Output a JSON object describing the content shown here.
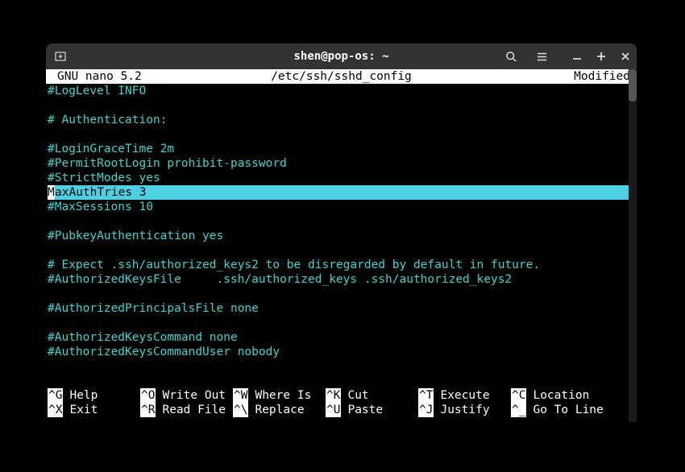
{
  "window": {
    "title": "shen@pop-os: ~"
  },
  "nano": {
    "header_title": "GNU nano 5.2",
    "header_file": "/etc/ssh/sshd_config",
    "header_status": "Modified"
  },
  "lines": [
    {
      "text": "#LogLevel INFO",
      "class": "cyan"
    },
    {
      "text": "",
      "class": ""
    },
    {
      "text": "# Authentication:",
      "class": "cyan"
    },
    {
      "text": "",
      "class": ""
    },
    {
      "text": "#LoginGraceTime 2m",
      "class": "cyan"
    },
    {
      "text": "#PermitRootLogin prohibit-password",
      "class": "cyan"
    },
    {
      "text": "#StrictModes yes",
      "class": "cyan"
    },
    {
      "text": "MaxAuthTries 3",
      "class": "highlighted",
      "cursor_char": "M",
      "rest": "axAuthTries 3"
    },
    {
      "text": "#MaxSessions 10",
      "class": "cyan"
    },
    {
      "text": "",
      "class": ""
    },
    {
      "text": "#PubkeyAuthentication yes",
      "class": "cyan"
    },
    {
      "text": "",
      "class": ""
    },
    {
      "text": "# Expect .ssh/authorized_keys2 to be disregarded by default in future.",
      "class": "cyan"
    },
    {
      "text": "#AuthorizedKeysFile     .ssh/authorized_keys .ssh/authorized_keys2",
      "class": "cyan"
    },
    {
      "text": "",
      "class": ""
    },
    {
      "text": "#AuthorizedPrincipalsFile none",
      "class": "cyan"
    },
    {
      "text": "",
      "class": ""
    },
    {
      "text": "#AuthorizedKeysCommand none",
      "class": "cyan"
    },
    {
      "text": "#AuthorizedKeysCommandUser nobody",
      "class": "cyan"
    },
    {
      "text": "",
      "class": ""
    },
    {
      "text": "",
      "class": ""
    }
  ],
  "shortcuts": {
    "row1": [
      {
        "key": "^G",
        "label": "Help"
      },
      {
        "key": "^O",
        "label": "Write Out"
      },
      {
        "key": "^W",
        "label": "Where Is"
      },
      {
        "key": "^K",
        "label": "Cut"
      },
      {
        "key": "^T",
        "label": "Execute"
      },
      {
        "key": "^C",
        "label": "Location"
      }
    ],
    "row2": [
      {
        "key": "^X",
        "label": "Exit"
      },
      {
        "key": "^R",
        "label": "Read File"
      },
      {
        "key": "^\\",
        "label": "Replace"
      },
      {
        "key": "^U",
        "label": "Paste"
      },
      {
        "key": "^J",
        "label": "Justify"
      },
      {
        "key": "^_",
        "label": "Go To Line"
      }
    ]
  }
}
